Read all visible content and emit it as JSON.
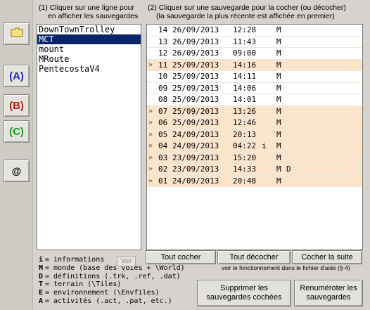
{
  "left_buttons": {
    "folder_icon": "folder-icon",
    "a_label": "(A)",
    "b_label": "(B)",
    "c_label": "(C)",
    "at_label": "@",
    "colors": {
      "a": "#2323c8",
      "b": "#b41e1e",
      "c": "#14a014"
    }
  },
  "left_panel": {
    "caption_line1": "(1) Cliquer sur une ligne pour",
    "caption_line2": "en afficher les sauvegardes",
    "items": [
      "DownTownTrolley",
      "MCT",
      "mount",
      "MRoute",
      "PentecostaV4"
    ],
    "selected": "MCT"
  },
  "right_panel": {
    "caption_line1": "(2) Cliquer sur une sauvegarde pour la cocher (ou décocher)",
    "caption_line2": "(la sauvegarde la plus récente est affichée en premier)",
    "rows": [
      {
        "mark": "",
        "num": "14",
        "date": "26/09/2013",
        "time": "12:28",
        "i": "",
        "m": "M",
        "d": ""
      },
      {
        "mark": "",
        "num": "13",
        "date": "26/09/2013",
        "time": "11:43",
        "i": "",
        "m": "M",
        "d": ""
      },
      {
        "mark": "",
        "num": "12",
        "date": "26/09/2013",
        "time": "09:00",
        "i": "",
        "m": "M",
        "d": ""
      },
      {
        "mark": "»",
        "num": "11",
        "date": "25/09/2013",
        "time": "14:16",
        "i": "",
        "m": "M",
        "d": ""
      },
      {
        "mark": "",
        "num": "10",
        "date": "25/09/2013",
        "time": "14:11",
        "i": "",
        "m": "M",
        "d": ""
      },
      {
        "mark": "",
        "num": "09",
        "date": "25/09/2013",
        "time": "14:06",
        "i": "",
        "m": "M",
        "d": ""
      },
      {
        "mark": "",
        "num": "08",
        "date": "25/09/2013",
        "time": "14:01",
        "i": "",
        "m": "M",
        "d": ""
      },
      {
        "mark": "»",
        "num": "07",
        "date": "25/09/2013",
        "time": "13:26",
        "i": "",
        "m": "M",
        "d": ""
      },
      {
        "mark": "»",
        "num": "06",
        "date": "25/09/2013",
        "time": "12:46",
        "i": "",
        "m": "M",
        "d": ""
      },
      {
        "mark": "»",
        "num": "05",
        "date": "24/09/2013",
        "time": "20:13",
        "i": "",
        "m": "M",
        "d": ""
      },
      {
        "mark": "»",
        "num": "04",
        "date": "24/09/2013",
        "time": "04:22",
        "i": "i",
        "m": "M",
        "d": ""
      },
      {
        "mark": "»",
        "num": "03",
        "date": "23/09/2013",
        "time": "15:20",
        "i": "",
        "m": "M",
        "d": ""
      },
      {
        "mark": "»",
        "num": "02",
        "date": "23/09/2013",
        "time": "14:33",
        "i": "",
        "m": "M",
        "d": "D"
      },
      {
        "mark": "»",
        "num": "01",
        "date": "24/09/2013",
        "time": "20:48",
        "i": "",
        "m": "M",
        "d": ""
      }
    ]
  },
  "legend": {
    "lines": [
      {
        "key": "i",
        "text": "= informations"
      },
      {
        "key": "M",
        "text": "= monde (base des voies + \\World)"
      },
      {
        "key": "D",
        "text": "= définitions (.trk, .ref, .dat)"
      },
      {
        "key": "T",
        "text": "= terrain (\\Tiles)"
      },
      {
        "key": "E",
        "text": "= environnement (\\Envfiles)"
      },
      {
        "key": "A",
        "text": "= activités (.act, .pat, etc.)"
      }
    ],
    "voir_label": "Voir"
  },
  "buttons": {
    "check_all": "Tout cocher",
    "uncheck_all": "Tout décocher",
    "check_next": "Cocher la suite",
    "help_note": "voir le fonctionnement dans le fichier d'aide (§ 4)",
    "delete_line1": "Supprimer les",
    "delete_line2": "sauvegardes cochées",
    "renumber_line1": "Renuméroter les",
    "renumber_line2": "sauvegardes"
  },
  "colors": {
    "checked_row": "#fde5cc",
    "selection": "#0a246a"
  }
}
